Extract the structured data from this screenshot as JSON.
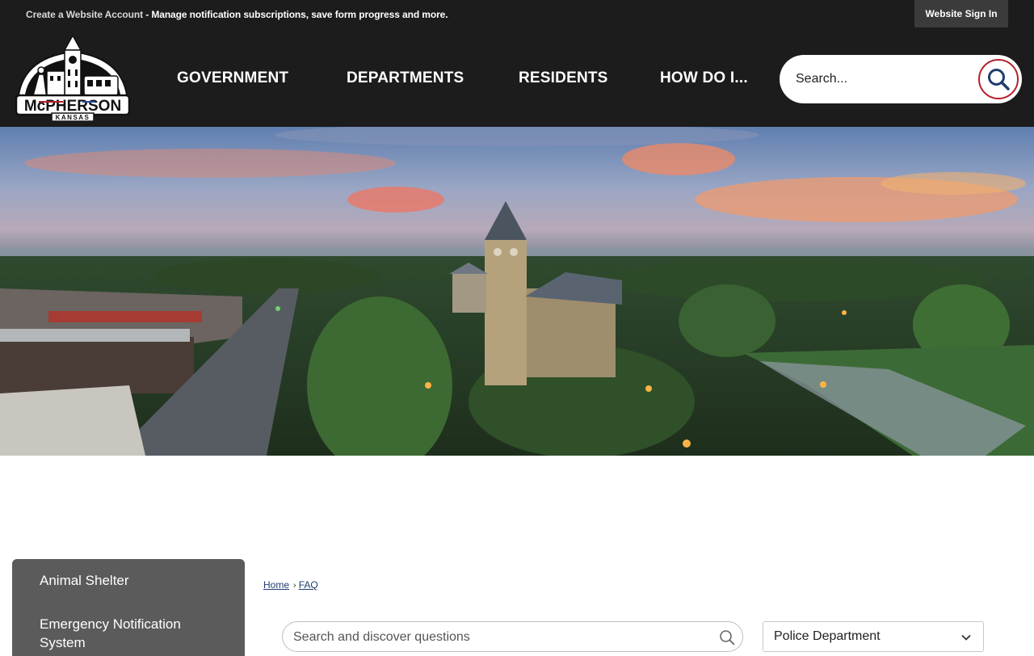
{
  "topbar": {
    "create_account_link": "Create a Website Account",
    "create_account_rest": " - Manage notification subscriptions, save form progress and more.",
    "signin_label": "Website Sign In"
  },
  "logo": {
    "text": "McPHERSON",
    "subtext": "KANSAS"
  },
  "nav": {
    "items": [
      {
        "label": "GOVERNMENT"
      },
      {
        "label": "DEPARTMENTS"
      },
      {
        "label": "RESIDENTS"
      },
      {
        "label": "HOW DO I..."
      }
    ]
  },
  "search": {
    "placeholder": "Search...",
    "icon": "search-icon"
  },
  "sidebar": {
    "items": [
      {
        "label": "Animal Shelter"
      },
      {
        "label": "Emergency Notification System"
      }
    ]
  },
  "breadcrumb": {
    "items": [
      {
        "label": "Home"
      },
      {
        "label": "FAQ"
      }
    ],
    "separator": "›"
  },
  "faq": {
    "search_placeholder": "Search and discover questions",
    "category_selected": "Police Department"
  },
  "colors": {
    "header_bg": "#1c1c1c",
    "accent_red": "#b3202a",
    "sidebar_bg": "#5b5b5b",
    "link_blue": "#1f3d6e"
  }
}
